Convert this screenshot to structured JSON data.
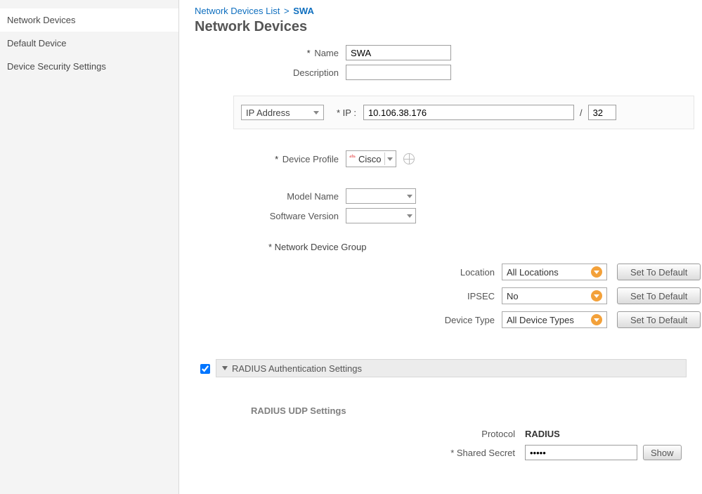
{
  "sidebar": {
    "items": [
      {
        "label": "Network Devices"
      },
      {
        "label": "Default Device"
      },
      {
        "label": "Device Security Settings"
      }
    ]
  },
  "breadcrumb": {
    "parent": "Network Devices List",
    "sep": ">",
    "current": "SWA"
  },
  "page_title": "Network Devices",
  "form": {
    "name_label": "Name",
    "name_value": "SWA",
    "description_label": "Description",
    "description_value": ""
  },
  "ip": {
    "type_label": "IP Address",
    "field_label": "* IP  :",
    "value": "10.106.38.176",
    "slash": "/",
    "mask": "32"
  },
  "profile": {
    "label": "Device Profile",
    "value": "Cisco"
  },
  "model": {
    "label": "Model Name",
    "value": ""
  },
  "software": {
    "label": "Software Version",
    "value": ""
  },
  "ndg": {
    "header": "*  Network Device Group",
    "location_label": "Location",
    "location_value": "All Locations",
    "ipsec_label": "IPSEC",
    "ipsec_value": "No",
    "device_type_label": "Device Type",
    "device_type_value": "All Device Types",
    "set_default": "Set To Default"
  },
  "radius": {
    "accordion_title": "RADIUS Authentication Settings",
    "udp_title": "RADIUS UDP Settings",
    "protocol_label": "Protocol",
    "protocol_value": "RADIUS",
    "secret_label": "* Shared Secret",
    "secret_value": "•••••",
    "show_label": "Show"
  }
}
